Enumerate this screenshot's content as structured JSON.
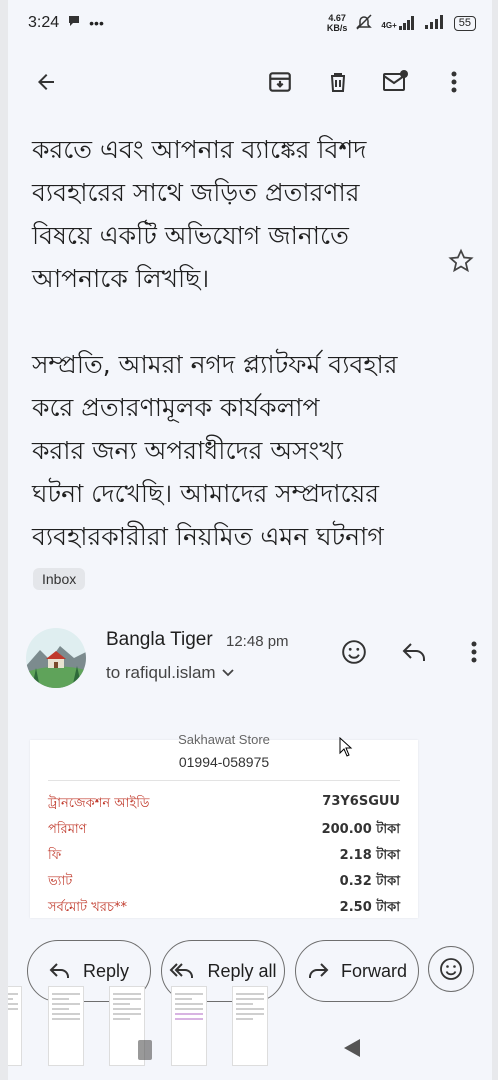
{
  "status_bar": {
    "time": "3:24",
    "net_speed_value": "4.67",
    "net_speed_unit": "KB/s",
    "network_label": "4G+",
    "battery": "55"
  },
  "app_bar": {
    "icons": [
      "back-arrow-icon",
      "archive-icon",
      "delete-icon",
      "mark-unread-icon",
      "more-vert-icon"
    ]
  },
  "email": {
    "body_lines_para1": [
      "করতে এবং আপনার ব্যাঙ্কের বিশদ",
      "ব্যবহারের সাথে জড়িত প্রতারণার",
      "বিষয়ে একটি অভিযোগ জানাতে",
      "আপনাকে লিখছি।"
    ],
    "body_lines_para2": [
      "সম্প্রতি, আমরা নগদ প্ল্যাটফর্ম ব্যবহার",
      "করে প্রতারণামূলক কার্যকলাপ",
      "করার জন্য অপরাধীদের অসংখ্য",
      "ঘটনা দেখেছি। আমাদের সম্প্রদায়ের",
      "ব্যবহারকারীরা নিয়মিত এমন ঘটনাগ"
    ],
    "label_chip": "Inbox"
  },
  "sender": {
    "name": "Bangla Tiger",
    "time": "12:48 pm",
    "to": "to rafiqul.islam"
  },
  "receipt": {
    "store_name_partial": "Sakhawat Store",
    "phone": "01994-058975",
    "rows": [
      {
        "label": "ট্রানজেকশন আইডি",
        "value": "73Y6SGUU"
      },
      {
        "label": "পরিমাণ",
        "value": "200.00 টাকা"
      },
      {
        "label": "ফি",
        "value": "2.18 টাকা"
      },
      {
        "label": "ভ্যাট",
        "value": "0.32 টাকা"
      },
      {
        "label": "সর্বমোট খরচ**",
        "value": "2.50 টাকা"
      }
    ]
  },
  "actions": {
    "reply": "Reply",
    "reply_all": "Reply all",
    "forward": "Forward"
  },
  "colors": {
    "accent_red": "#c0392b",
    "background": "#f4f6fb"
  }
}
